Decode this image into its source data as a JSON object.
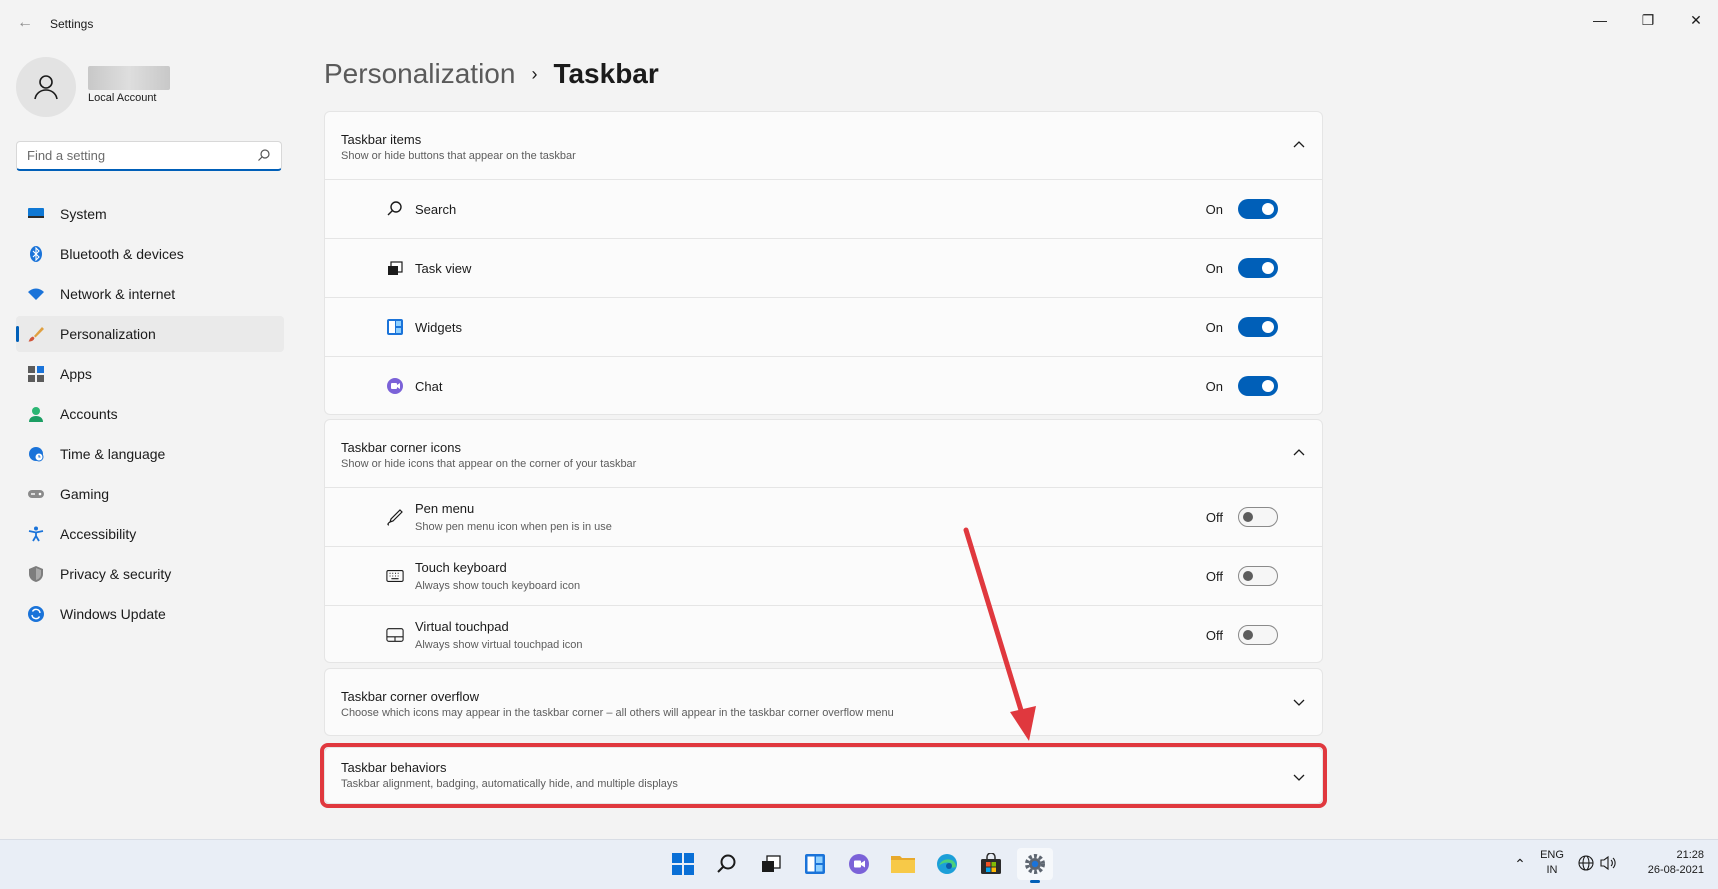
{
  "window": {
    "title": "Settings"
  },
  "account": {
    "type": "Local Account"
  },
  "search": {
    "placeholder": "Find a setting"
  },
  "sidebar": {
    "items": [
      {
        "label": "System",
        "icon": "system-icon"
      },
      {
        "label": "Bluetooth & devices",
        "icon": "bluetooth-icon"
      },
      {
        "label": "Network & internet",
        "icon": "wifi-icon"
      },
      {
        "label": "Personalization",
        "icon": "brush-icon",
        "active": true
      },
      {
        "label": "Apps",
        "icon": "apps-icon"
      },
      {
        "label": "Accounts",
        "icon": "accounts-icon"
      },
      {
        "label": "Time & language",
        "icon": "globe-clock-icon"
      },
      {
        "label": "Gaming",
        "icon": "gamepad-icon"
      },
      {
        "label": "Accessibility",
        "icon": "accessibility-icon"
      },
      {
        "label": "Privacy & security",
        "icon": "shield-icon"
      },
      {
        "label": "Windows Update",
        "icon": "update-icon"
      }
    ]
  },
  "header": {
    "parent": "Personalization",
    "separator": "›",
    "current": "Taskbar"
  },
  "sections": {
    "items": {
      "title": "Taskbar items",
      "subtitle": "Show or hide buttons that appear on the taskbar",
      "rows": [
        {
          "label": "Search",
          "state": "On"
        },
        {
          "label": "Task view",
          "state": "On"
        },
        {
          "label": "Widgets",
          "state": "On"
        },
        {
          "label": "Chat",
          "state": "On"
        }
      ]
    },
    "corner_icons": {
      "title": "Taskbar corner icons",
      "subtitle": "Show or hide icons that appear on the corner of your taskbar",
      "rows": [
        {
          "label": "Pen menu",
          "sub": "Show pen menu icon when pen is in use",
          "state": "Off"
        },
        {
          "label": "Touch keyboard",
          "sub": "Always show touch keyboard icon",
          "state": "Off"
        },
        {
          "label": "Virtual touchpad",
          "sub": "Always show virtual touchpad icon",
          "state": "Off"
        }
      ]
    },
    "overflow": {
      "title": "Taskbar corner overflow",
      "subtitle": "Choose which icons may appear in the taskbar corner – all others will appear in the taskbar corner overflow menu"
    },
    "behaviors": {
      "title": "Taskbar behaviors",
      "subtitle": "Taskbar alignment, badging, automatically hide, and multiple displays"
    }
  },
  "taskbar": {
    "lang_top": "ENG",
    "lang_bottom": "IN",
    "time": "21:28",
    "date": "26-08-2021"
  },
  "colors": {
    "accent": "#005fb8",
    "highlight": "#e0383e"
  }
}
